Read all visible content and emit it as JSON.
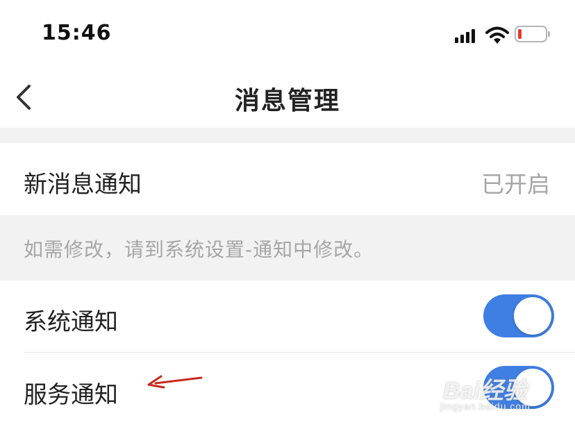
{
  "status_bar": {
    "time": "15:46",
    "icons": [
      "cellular-signal-icon",
      "wifi-icon",
      "battery-low-icon"
    ]
  },
  "nav": {
    "title": "消息管理",
    "back_icon": "chevron-left-icon"
  },
  "settings": {
    "new_message": {
      "label": "新消息通知",
      "value": "已开启"
    },
    "hint": "如需修改，请到系统设置-通知中修改。",
    "system_notification": {
      "label": "系统通知",
      "enabled": true
    },
    "service_notification": {
      "label": "服务通知",
      "enabled": true
    }
  },
  "annotation": {
    "icon": "red-arrow-icon",
    "color": "#c8281e"
  },
  "watermark": {
    "brand": "Bai经验",
    "url": "jingyan.baidu.com"
  },
  "colors": {
    "accent": "#3f7ee2",
    "muted_text": "#a6a6a6",
    "section_bg": "#f2f2f2"
  }
}
